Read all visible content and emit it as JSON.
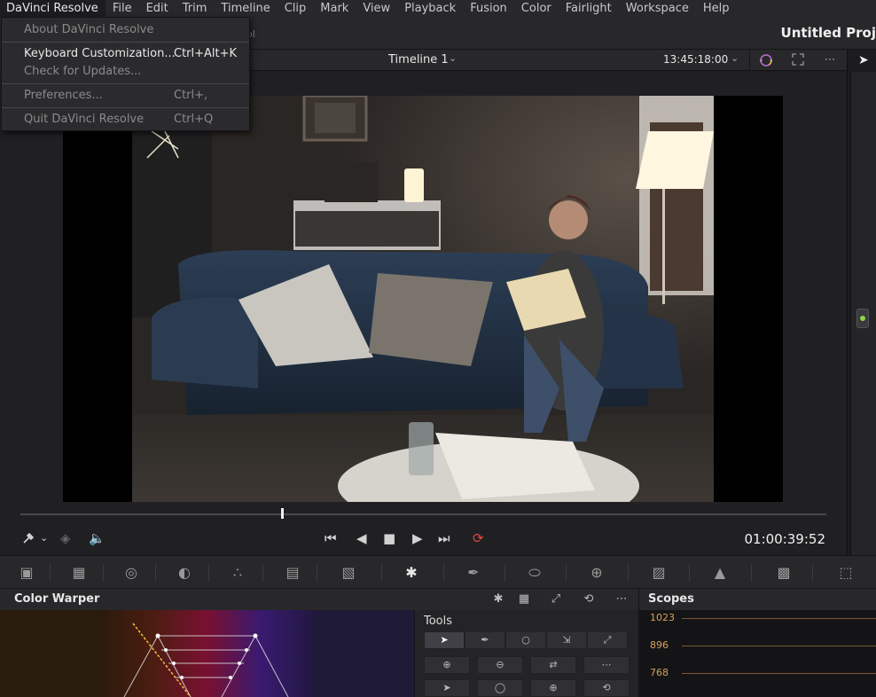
{
  "menubar": {
    "items": [
      "DaVinci Resolve",
      "File",
      "Edit",
      "Trim",
      "Timeline",
      "Clip",
      "Mark",
      "View",
      "Playback",
      "Fusion",
      "Color",
      "Fairlight",
      "Workspace",
      "Help"
    ]
  },
  "dropdown": {
    "items": [
      {
        "label": "About DaVinci Resolve",
        "shortcut": "",
        "enabled": false
      },
      {
        "label": "Keyboard Customization...",
        "shortcut": "Ctrl+Alt+K",
        "enabled": true
      },
      {
        "label": "Check for Updates...",
        "shortcut": "",
        "enabled": false
      },
      {
        "label": "Preferences...",
        "shortcut": "Ctrl+,",
        "enabled": false
      },
      {
        "label": "Quit DaVinci Resolve",
        "shortcut": "Ctrl+Q",
        "enabled": false
      }
    ]
  },
  "project": {
    "title": "Untitled Proj",
    "partial_label": "ol"
  },
  "viewer": {
    "timeline_name": "Timeline 1",
    "timecode_top": "13:45:18:00",
    "timecode_bottom": "01:00:39:52",
    "playhead_progress": 0.325
  },
  "colors": {
    "accent_loop": "#e2493f",
    "node_green": "#8fd44a",
    "scope_label": "#d9a05a"
  },
  "icons": {
    "viewer_header": [
      "color-wheel-icon",
      "fullscreen-icon",
      "more-icon",
      "pointer-icon"
    ],
    "transport": [
      "picker-icon",
      "chevron-down-icon",
      "layers-icon",
      "speaker-icon",
      "first-frame-icon",
      "prev-frame-icon",
      "stop-icon",
      "play-icon",
      "last-frame-icon",
      "loop-icon"
    ],
    "palette": [
      "camera-raw-icon",
      "color-match-icon",
      "primaries-icon",
      "hdr-icon",
      "rgb-mixer-icon",
      "motion-effects-icon",
      "curves-icon",
      "color-warper-icon",
      "qualifier-icon",
      "window-icon",
      "tracker-icon",
      "magic-mask-icon",
      "blur-icon",
      "key-icon",
      "sizing-icon"
    ]
  },
  "color_warper": {
    "title": "Color Warper",
    "header_icons": [
      "warper-hue-sat-icon",
      "grid-icon",
      "expand-icon",
      "reset-icon",
      "more-icon"
    ]
  },
  "tools": {
    "label": "Tools"
  },
  "scopes": {
    "title": "Scopes",
    "labels": [
      "1023",
      "896",
      "768"
    ]
  }
}
